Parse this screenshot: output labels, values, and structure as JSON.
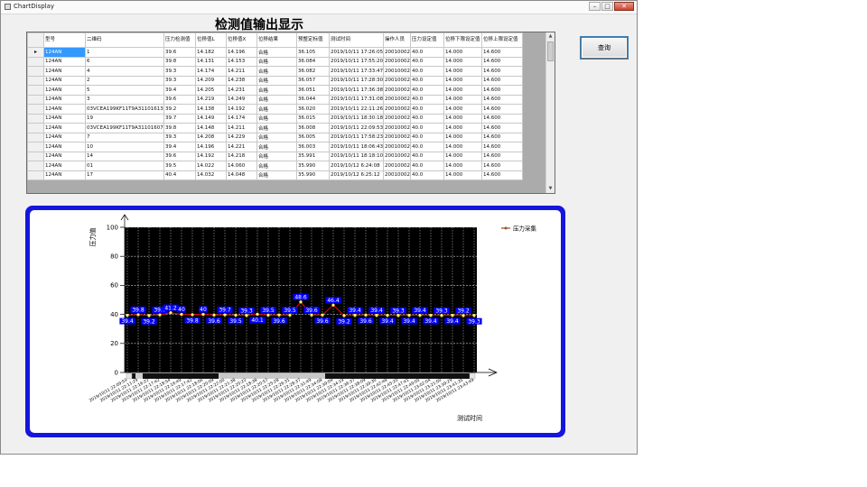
{
  "window": {
    "title": "ChartDisplay",
    "minimize": "–",
    "maximize": "□",
    "close": "✕"
  },
  "page_title": "检测值输出显示",
  "query_button": "查询",
  "grid": {
    "headers": [
      "型号",
      "二维码",
      "压力检测值",
      "位移值L",
      "位移值X",
      "位移结果",
      "预整定标值",
      "测试时间",
      "操作人员",
      "压力设定值",
      "位移下限设定值",
      "位移上限设定值"
    ],
    "rows": [
      [
        "124AN",
        "1",
        "39.6",
        "14.182",
        "14.196",
        "合格",
        "36.105",
        "2019/10/11 17:26:05",
        "20010002",
        "40.0",
        "14.000",
        "14.600"
      ],
      [
        "124AN",
        "6",
        "39.8",
        "14.131",
        "14.153",
        "合格",
        "36.084",
        "2019/10/11 17:55:20",
        "20010002",
        "40.0",
        "14.000",
        "14.600"
      ],
      [
        "124AN",
        "4",
        "39.3",
        "14.174",
        "14.211",
        "合格",
        "36.082",
        "2019/10/11 17:33:47",
        "20010002",
        "40.0",
        "14.000",
        "14.600"
      ],
      [
        "124AN",
        "2",
        "39.3",
        "14.209",
        "14.238",
        "合格",
        "36.057",
        "2019/10/11 17:28:30",
        "20010002",
        "40.0",
        "14.000",
        "14.600"
      ],
      [
        "124AN",
        "5",
        "39.4",
        "14.205",
        "14.231",
        "合格",
        "36.051",
        "2019/10/11 17:36:38",
        "20010002",
        "40.0",
        "14.000",
        "14.600"
      ],
      [
        "124AN",
        "3",
        "39.6",
        "14.219",
        "14.249",
        "合格",
        "36.044",
        "2019/10/11 17:31:08",
        "20010002",
        "40.0",
        "14.000",
        "14.600"
      ],
      [
        "124AN",
        "03VCEA199KF11T9A31101613",
        "39.2",
        "14.138",
        "14.192",
        "合格",
        "36.020",
        "2019/10/11 22:11:26",
        "20010002",
        "40.0",
        "14.000",
        "14.600"
      ],
      [
        "124AN",
        "19",
        "39.7",
        "14.149",
        "14.174",
        "合格",
        "36.015",
        "2019/10/11 18:30:18",
        "20010002",
        "40.0",
        "14.000",
        "14.600"
      ],
      [
        "124AN",
        "03VCEA199KF11T9A31101607",
        "39.8",
        "14.148",
        "14.211",
        "合格",
        "36.008",
        "2019/10/11 22:09:53",
        "20010002",
        "40.0",
        "14.000",
        "14.600"
      ],
      [
        "124AN",
        "7",
        "39.3",
        "14.208",
        "14.229",
        "合格",
        "36.005",
        "2019/10/11 17:58:23",
        "20010002",
        "40.0",
        "14.000",
        "14.600"
      ],
      [
        "124AN",
        "10",
        "39.4",
        "14.196",
        "14.221",
        "合格",
        "36.003",
        "2019/10/11 18:06:43",
        "20010002",
        "40.0",
        "14.000",
        "14.600"
      ],
      [
        "124AN",
        "14",
        "39.6",
        "14.192",
        "14.218",
        "合格",
        "35.991",
        "2019/10/11 18:18:10",
        "20010002",
        "40.0",
        "14.000",
        "14.600"
      ],
      [
        "124AN",
        "01",
        "39.5",
        "14.022",
        "14.060",
        "合格",
        "35.990",
        "2019/10/12 6:24:08",
        "20010002",
        "40.0",
        "14.000",
        "14.600"
      ],
      [
        "124AN",
        "17",
        "40.4",
        "14.032",
        "14.048",
        "合格",
        "35.990",
        "2019/10/12 6:25:12",
        "20010002",
        "40.0",
        "14.000",
        "14.600"
      ]
    ]
  },
  "chart_data": {
    "type": "line",
    "ylabel": "压力值",
    "xlabel": "测试时间",
    "ylim": [
      0,
      100
    ],
    "yticks": [
      0,
      20,
      40,
      60,
      80,
      100
    ],
    "grid": true,
    "legend_position": "top-right",
    "colors": {
      "plot_bg": "#000000",
      "line": "#ff0000",
      "marker": "#ffff66",
      "label_bg": "#0000ff",
      "label_text": "#ffffff",
      "legend_line": "#a0522d"
    },
    "series": [
      {
        "name": "压力采集",
        "values": [
          39.4,
          39.8,
          39.2,
          39.7,
          41.2,
          40,
          39.8,
          40,
          39.6,
          39.7,
          39.5,
          39.3,
          40.1,
          39.5,
          39.6,
          39.5,
          48.6,
          39.6,
          39.6,
          46.4,
          39.2,
          39.4,
          39.6,
          39.4,
          39.4,
          39.3,
          39.4,
          39.4,
          39.4,
          39.3,
          39.4,
          39.2,
          39.3
        ]
      }
    ],
    "x": [
      "2019/10/11 22:09:53",
      "2019/10/11 22:11:29",
      "2019/10/11 22:16:22",
      "2019/10/11 22:17:42",
      "2019/10/11 22:18:54",
      "2019/10/11 22:16:49",
      "2019/10/11 22:17:42",
      "2019/10/11 22:18:06",
      "2019/10/11 22:20:09",
      "2019/10/11 22:22:00",
      "2019/10/11 22:21:38",
      "2019/10/11 22:20:22",
      "2019/10/11 22:18:38",
      "2019/10/11 22:20:57",
      "2019/10/11 22:25:28",
      "2019/10/11 22:26:31",
      "2019/10/11 22:28:37",
      "2019/10/11 22:31:49",
      "2019/10/11 22:34:08",
      "2019/10/11 22:39:09",
      "2019/10/11 22:34:19",
      "2019/10/11 22:36:37",
      "2019/10/11 22:38:09",
      "2019/10/11 22:39:30",
      "2019/10/11 22:42:48",
      "2019/10/11 22:45:20",
      "2019/10/11 22:47:41",
      "2019/10/11 22:49:05",
      "2019/10/11 23:02:04",
      "2019/10/11 23:21:00",
      "2019/10/11 23:39:29",
      "2019/10/11 23:41:35",
      "2019/10/11 23:43:49"
    ]
  }
}
